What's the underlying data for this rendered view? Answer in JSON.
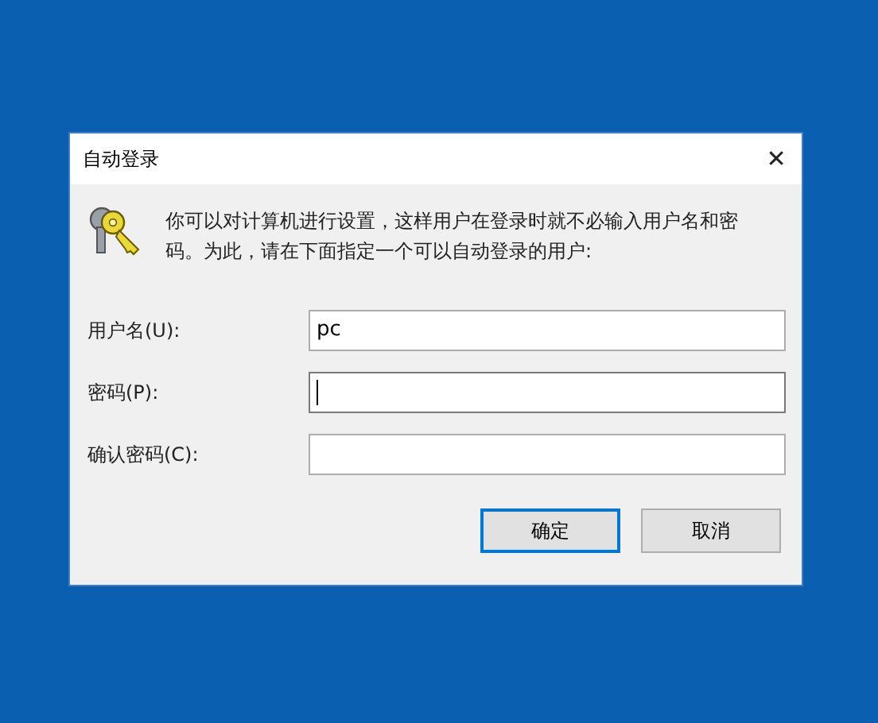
{
  "window": {
    "title": "自动登录",
    "close": "✕"
  },
  "message": "你可以对计算机进行设置，这样用户在登录时就不必输入用户名和密码。为此，请在下面指定一个可以自动登录的用户:",
  "fields": [
    {
      "label": "用户名(U):",
      "value": "pc",
      "focused": false
    },
    {
      "label": "密码(P):",
      "focused": true
    },
    {
      "label": "确认密码(C):",
      "focused": false
    }
  ],
  "buttons": [
    {
      "label": "确定",
      "default": true
    },
    {
      "label": "取消",
      "default": false
    }
  ]
}
